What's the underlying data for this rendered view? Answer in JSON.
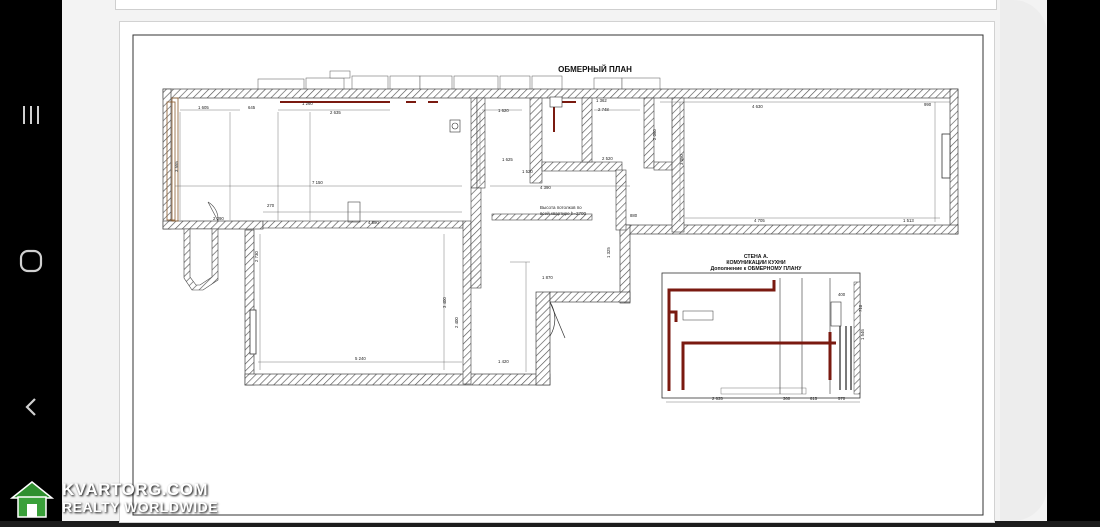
{
  "plan": {
    "title": "ОБМЕРНЫЙ ПЛАН",
    "ceiling_note_1": "Высота потолков по",
    "ceiling_note_2": "всей квартире h=2700",
    "dims": {
      "d1605": "1 605",
      "d645": "645",
      "d2635": "2 635",
      "d1260": "1 260",
      "d1620": "1 620",
      "d1362": "1 362",
      "d2748": "2 748",
      "d4630": "4 630",
      "d990": "990",
      "d270": "270",
      "d7150": "7 150",
      "d4590": "4 590",
      "d4390": "4 390",
      "d2520": "2 520",
      "d1625": "1 625",
      "d4705": "4 705",
      "d1513": "1 513",
      "d2290": "2 290",
      "d5240": "5 240",
      "d1420": "1 420",
      "d1870": "1 870",
      "d880": "880",
      "d3555": "3 555",
      "d3050": "3 050",
      "d2730": "2 730",
      "d3400": "3 400",
      "d2400": "2 400",
      "d1325": "1 325",
      "d2060": "2 060",
      "d1520": "1 520"
    }
  },
  "wall": {
    "title": "СТЕНА А.",
    "subtitle": "КОМУНИКАЦИИ КУХНИ",
    "subtitle2": "Дополнение к ОБМЕРНОМУ ПЛАНУ",
    "dims": {
      "w2635": "2 635",
      "w360": "360",
      "w615": "615",
      "w570": "570",
      "w1546": "1 546",
      "w710": "710",
      "w400": "400"
    }
  },
  "watermark": {
    "line1": "KVARTORG.COM",
    "line2": "REALTY WORLDWIDE"
  },
  "nav": {
    "recents_icon": "recents-icon",
    "home_icon": "home-icon",
    "back_icon": "back-icon"
  }
}
